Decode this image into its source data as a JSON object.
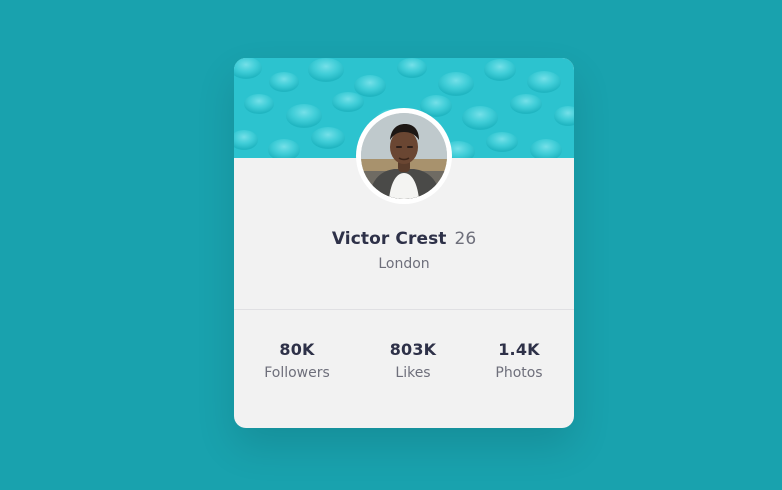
{
  "profile": {
    "name": "Victor Crest",
    "age": "26",
    "city": "London"
  },
  "stats": {
    "followers": {
      "value": "80K",
      "label": "Followers"
    },
    "likes": {
      "value": "803K",
      "label": "Likes"
    },
    "photos": {
      "value": "1.4K",
      "label": "Photos"
    }
  },
  "colors": {
    "page_background": "#19a2ae",
    "card_header": "#2cc3cf",
    "card_body": "#f2f2f2",
    "text_dark": "#2e3148",
    "text_muted": "#6e6f7b"
  }
}
